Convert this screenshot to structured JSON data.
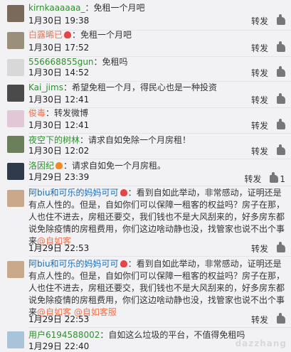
{
  "actions": {
    "repost": "转发",
    "like": "赞",
    "like_icon": "thumbs-up-icon"
  },
  "comments": [
    {
      "user": "kirnkaaaaaa_",
      "text": "：免租一个月吧",
      "time": "1月30日 19:38",
      "avatar_color": "#7a6a5c",
      "likes": ""
    },
    {
      "user": "白露晞已",
      "badge": true,
      "text": "：免租一个月吧",
      "time": "1月30日 17:52",
      "avatar_color": "#9a8f7a",
      "likes": ""
    },
    {
      "user": "556668855gun",
      "text": "：免租吗",
      "time": "1月30日 14:52",
      "avatar_color": "#d8d8d8",
      "likes": ""
    },
    {
      "user": "Kai_jims",
      "text": "：希望免租一个月，得民心也是一种投资",
      "time": "1月30日 12:41",
      "avatar_color": "#4a4a4a",
      "likes": ""
    },
    {
      "user": "俊毒",
      "text": "：转发微博",
      "time": "1月30日 12:41",
      "avatar_color": "#e2c8d6",
      "likes": ""
    },
    {
      "user": "夜空下的树林",
      "text": "：请求自如免除一个月房租！",
      "time": "1月30日 12:02",
      "avatar_color": "#6a7f5a",
      "likes": ""
    },
    {
      "user": "洛因纪",
      "badge": true,
      "text": "：请求自如免一个月房租。",
      "time": "1月29日 23:39",
      "avatar_color": "#2f3a4a",
      "likes": "1"
    },
    {
      "user": "阿biu和可乐的妈妈可可",
      "badge": true,
      "text": "：看到自如此举动，非常感动，证明还是有点人性的。但是，自如你们可以保障一租客的权益吗？房子在那，人也住不进去，房租还要交，我们钱也不是大风刮来的，好多房东都说免除疫情的房租费用，你们这边啥动静也没，找管家也说不出个事来",
      "mentions": [
        "@自如客"
      ],
      "time": "1月29日 22:53",
      "avatar_color": "#c9a98a",
      "likes": ""
    },
    {
      "user": "阿biu和可乐的妈妈可可",
      "badge": true,
      "text": "：看到自如此举动，非常感动，证明还是有点人性的。但是，自如你们可以保障一租客的权益吗？房子在那，人也住不进去，房租还要交，我们钱也不是大风刮来的，好多房东都说免除疫情的房租费用，你们这边啥动静也没，找管家也说不出个事来",
      "mentions": [
        "@自如客",
        "@自如客服"
      ],
      "time": "1月29日 22:53",
      "avatar_color": "#c9a98a",
      "likes": ""
    },
    {
      "user": "用户6194588002",
      "text": "：自如这么垃圾的平台，不值得免租吗",
      "time": "1月29日 22:40",
      "avatar_color": "#a9c4d9",
      "likes": ""
    }
  ],
  "watermark": "dazzhang"
}
